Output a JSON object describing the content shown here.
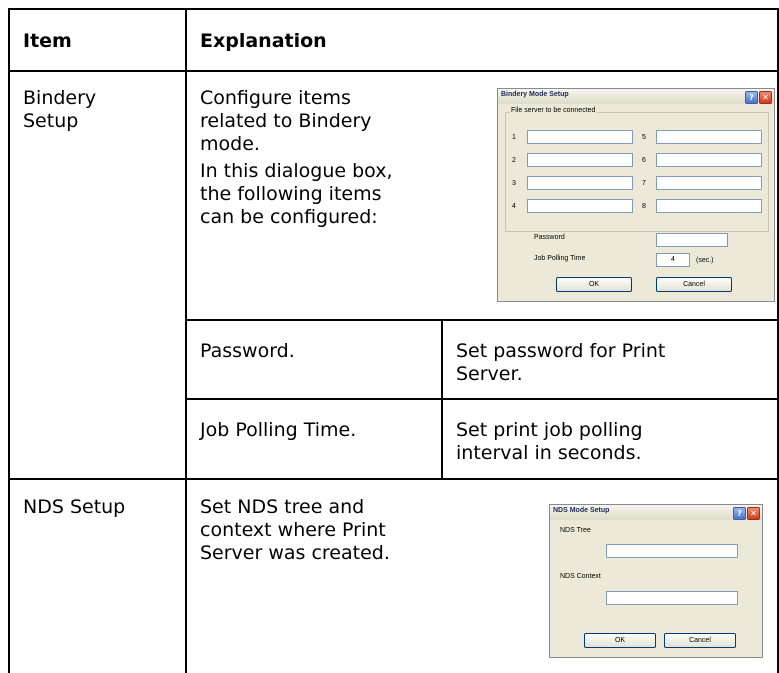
{
  "table": {
    "headers": {
      "item": "Item",
      "explanation": "Explanation"
    },
    "bindery": {
      "item": [
        "Bindery",
        "Setup"
      ],
      "description": [
        "Configure items",
        "related to Bindery",
        "mode."
      ],
      "description2": [
        "In this dialogue box,",
        "the following items",
        "can be configured:"
      ],
      "rows": [
        {
          "name": "Password.",
          "desc": [
            "Set password for Print",
            "Server."
          ]
        },
        {
          "name": "Job Polling Time.",
          "desc": [
            "Set print job polling",
            "interval in seconds."
          ]
        }
      ]
    },
    "nds": {
      "item": "NDS Setup",
      "description": [
        "Set NDS tree and",
        "context where Print",
        "Server was created."
      ]
    }
  },
  "bindery_dialog": {
    "title": "Bindery Mode Setup",
    "help_glyph": "?",
    "close_glyph": "✕",
    "group_label": "File server to be connected",
    "numbers": [
      "1",
      "2",
      "3",
      "4",
      "5",
      "6",
      "7",
      "8"
    ],
    "password_label": "Password",
    "polling_label": "Job Polling Time",
    "polling_value": "4",
    "polling_unit": "(sec.)",
    "ok_label": "OK",
    "cancel_label": "Cancel"
  },
  "nds_dialog": {
    "title": "NDS Mode Setup",
    "help_glyph": "?",
    "close_glyph": "✕",
    "tree_label": "NDS Tree",
    "context_label": "NDS Context",
    "ok_label": "OK",
    "cancel_label": "Cancel"
  }
}
